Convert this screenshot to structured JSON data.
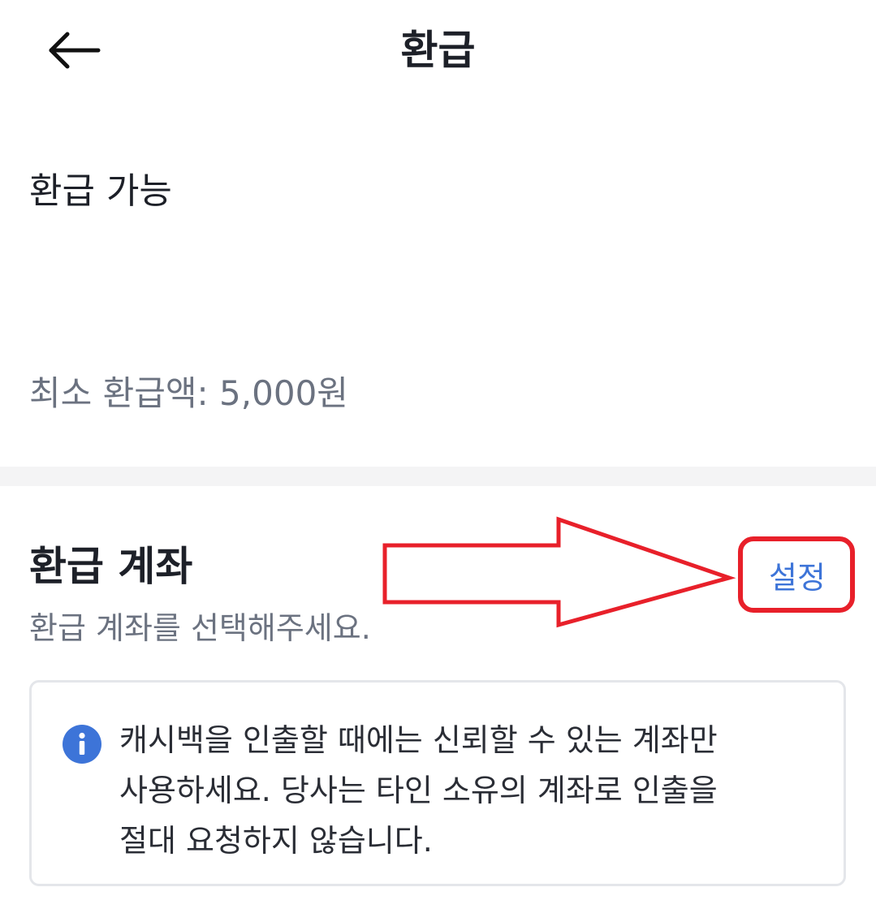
{
  "header": {
    "back_icon": "arrow-left-icon",
    "title": "환급"
  },
  "refund_available": {
    "label": "환급 가능",
    "min_amount": "최소 환급액: 5,000원"
  },
  "refund_account": {
    "title": "환급 계좌",
    "subtitle": "환급 계좌를 선택해주세요.",
    "setup_label": "설정"
  },
  "info_notice": {
    "icon": "info-icon",
    "lines": [
      "캐시백을 인출할 때에는 신뢰할 수 있는 계좌만",
      "사용하세요. 당사는 타인 소유의 계좌로 인출을",
      "절대 요청하지 않습니다."
    ]
  },
  "colors": {
    "accent": "#3d74d8",
    "annotation": "#e8202a",
    "text_primary": "#1d2028",
    "text_secondary": "#6b7280",
    "divider": "#f4f4f5"
  }
}
